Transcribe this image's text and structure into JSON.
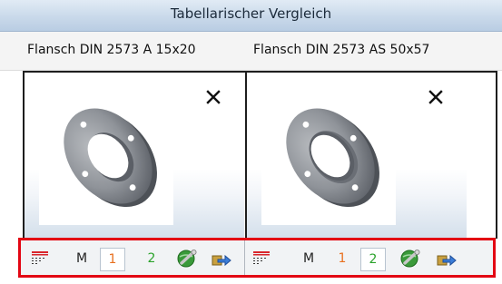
{
  "window": {
    "title": "Tabellarischer Vergleich"
  },
  "columns": [
    {
      "heading": "Flansch DIN 2573 A 15x20",
      "close_icon": "close-icon"
    },
    {
      "heading": "Flansch DIN 2573 AS 50x57",
      "close_icon": "close-icon"
    }
  ],
  "toolbars": [
    {
      "m_label": "M",
      "one_label": "1",
      "two_label": "2",
      "selected": "1"
    },
    {
      "m_label": "M",
      "one_label": "1",
      "two_label": "2",
      "selected": "2"
    }
  ],
  "colors": {
    "highlight_border": "#e30613",
    "one": "#e8701f",
    "two": "#2ba32b"
  },
  "icons": [
    "table-list-icon",
    "globe-wrench-icon",
    "export-arrow-icon",
    "close-icon"
  ]
}
